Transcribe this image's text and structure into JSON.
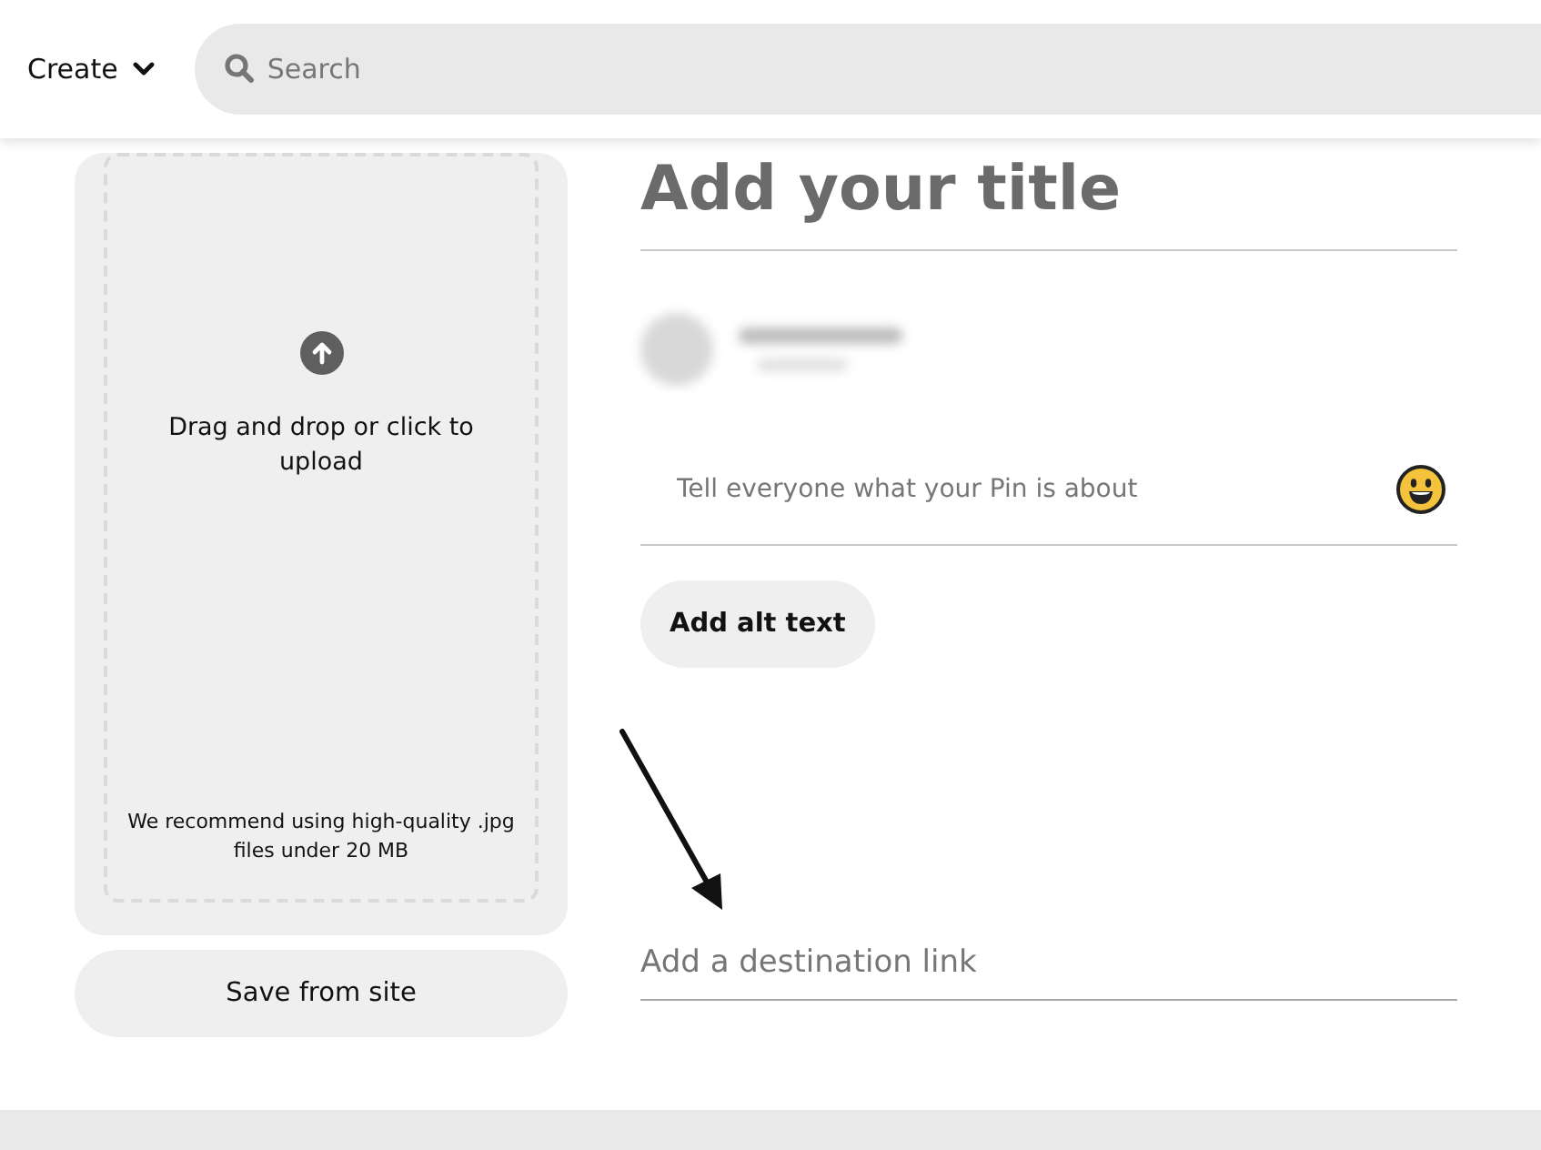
{
  "header": {
    "create_menu": {
      "label": "Create"
    },
    "search": {
      "placeholder": "Search"
    }
  },
  "upload": {
    "prompt": "Drag and drop or click to upload",
    "recommendation": "We recommend using high-quality .jpg files under 20 MB",
    "save_button": "Save from site"
  },
  "pin_form": {
    "title": {
      "placeholder": "Add your title"
    },
    "description": {
      "placeholder": "Tell everyone what your Pin is about"
    },
    "alt_text_button": "Add alt text",
    "destination": {
      "placeholder": "Add a destination link"
    }
  }
}
